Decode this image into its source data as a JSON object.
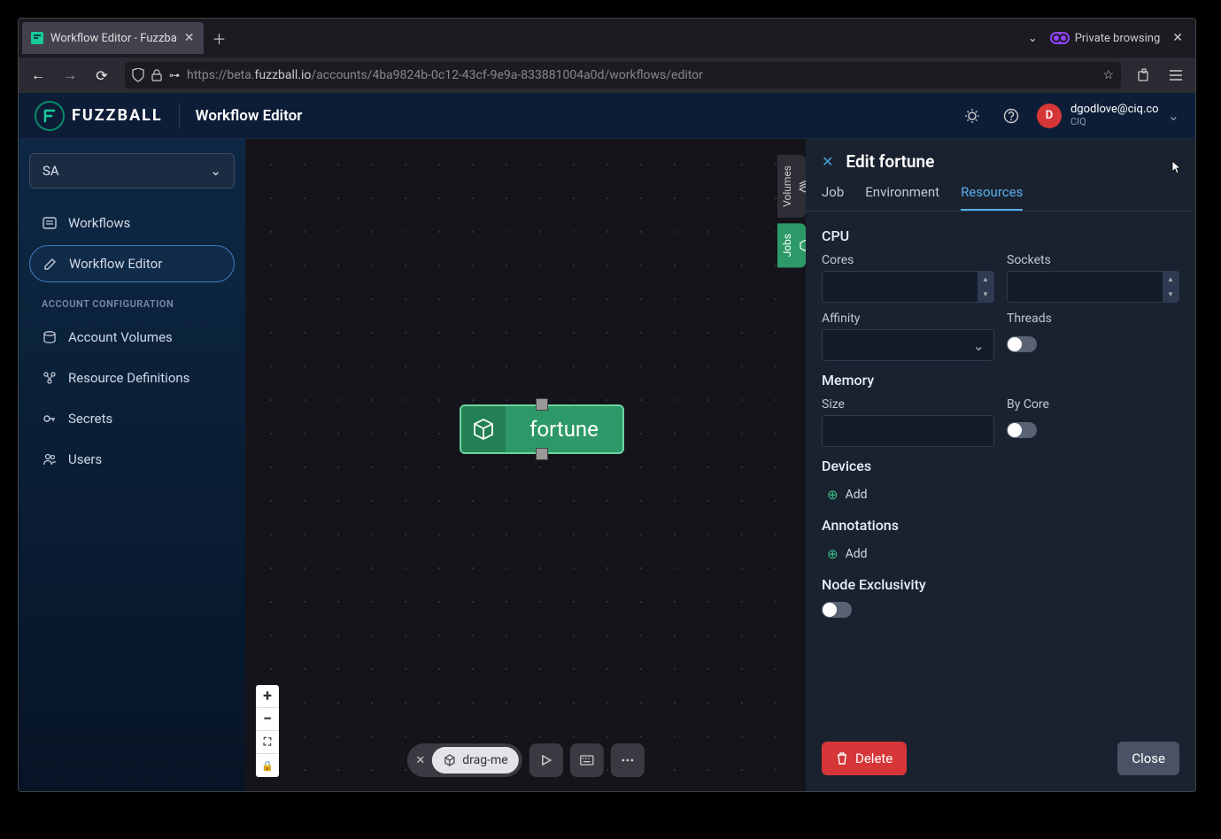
{
  "browser": {
    "tab_title": "Workflow Editor - Fuzzba",
    "private_label": "Private browsing",
    "url_proto": "https://",
    "url_host_pre": "beta.",
    "url_host_bold": "fuzzball.io",
    "url_path": "/accounts/4ba9824b-0c12-43cf-9e9a-833881004a0d/workflows/editor"
  },
  "header": {
    "brand": "FUZZBALL",
    "page_title": "Workflow Editor",
    "user_email": "dgodlove@ciq.co",
    "user_org": "CIQ",
    "avatar_initial": "D"
  },
  "sidebar": {
    "org": "SA",
    "items": [
      {
        "label": "Workflows"
      },
      {
        "label": "Workflow Editor"
      }
    ],
    "section": "ACCOUNT CONFIGURATION",
    "account_items": [
      {
        "label": "Account Volumes"
      },
      {
        "label": "Resource Definitions"
      },
      {
        "label": "Secrets"
      },
      {
        "label": "Users"
      }
    ]
  },
  "canvas": {
    "node_label": "fortune",
    "side_tab_volumes": "Volumes",
    "side_tab_jobs": "Jobs",
    "drag_label": "drag-me"
  },
  "panel": {
    "title": "Edit fortune",
    "tabs": {
      "job": "Job",
      "env": "Environment",
      "res": "Resources"
    },
    "cpu": "CPU",
    "cores": "Cores",
    "sockets": "Sockets",
    "affinity": "Affinity",
    "threads": "Threads",
    "memory": "Memory",
    "size": "Size",
    "bycore": "By Core",
    "devices": "Devices",
    "annotations": "Annotations",
    "add": "Add",
    "node_excl": "Node Exclusivity",
    "delete": "Delete",
    "close": "Close"
  }
}
